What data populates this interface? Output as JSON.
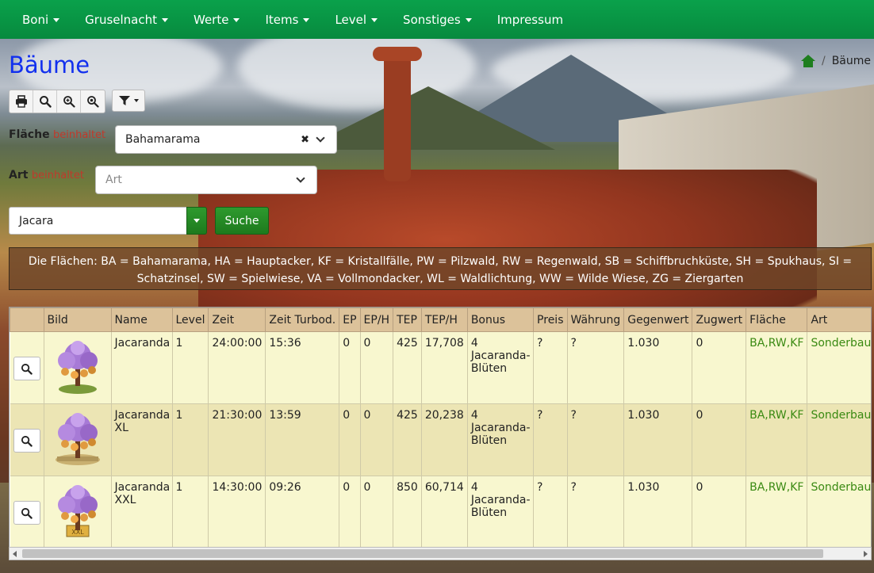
{
  "nav": {
    "items": [
      {
        "label": "Boni",
        "dropdown": true
      },
      {
        "label": "Gruselnacht",
        "dropdown": true
      },
      {
        "label": "Werte",
        "dropdown": true
      },
      {
        "label": "Items",
        "dropdown": true
      },
      {
        "label": "Level",
        "dropdown": true
      },
      {
        "label": "Sonstiges",
        "dropdown": true
      },
      {
        "label": "Impressum",
        "dropdown": false
      }
    ]
  },
  "page": {
    "title": "Bäume",
    "breadcrumb_separator": "/",
    "breadcrumb_current": "Bäume"
  },
  "toolbar": {
    "icons": [
      "printer-icon",
      "search-icon",
      "zoom-in-icon",
      "zoom-reset-icon",
      "filter-icon"
    ]
  },
  "filters": {
    "flaeche": {
      "label": "Fläche",
      "operator": "beinhaltet",
      "value": "Bahamarama"
    },
    "art": {
      "label": "Art",
      "operator": "beinhaltet",
      "placeholder": "Art"
    }
  },
  "search": {
    "value": "Jacara",
    "button_label": "Suche"
  },
  "legend_text": "Die Flächen: BA = Bahamarama, HA = Hauptacker, KF = Kristallfälle, PW = Pilzwald, RW = Regenwald, SB = Schiffbruchküste, SH = Spukhaus, SI = Schatzinsel, SW = Spielwiese, VA = Vollmondacker, WL = Waldlichtung, WW = Wilde Wiese, ZG = Ziergarten",
  "table": {
    "columns": [
      "",
      "Bild",
      "Name",
      "Level",
      "Zeit",
      "Zeit Turbod.",
      "EP",
      "EP/H",
      "TEP",
      "TEP/H",
      "Bonus",
      "Preis",
      "Währung",
      "Gegenwert",
      "Zugwert",
      "Fläche",
      "Art"
    ],
    "rows": [
      {
        "name": "Jacaranda",
        "level": "1",
        "zeit": "24:00:00",
        "zeit_turbo": "15:36",
        "ep": "0",
        "ep_h": "0",
        "tep": "425",
        "tep_h": "17,708",
        "bonus": "4 Jacaranda-Blüten",
        "preis": "?",
        "waehrung": "?",
        "gegenwert": "1.030",
        "zugwert": "0",
        "flaeche": "BA,RW,KF",
        "art": "Sonderbaum"
      },
      {
        "name": "Jacaranda XL",
        "level": "1",
        "zeit": "21:30:00",
        "zeit_turbo": "13:59",
        "ep": "0",
        "ep_h": "0",
        "tep": "425",
        "tep_h": "20,238",
        "bonus": "4 Jacaranda-Blüten",
        "preis": "?",
        "waehrung": "?",
        "gegenwert": "1.030",
        "zugwert": "0",
        "flaeche": "BA,RW,KF",
        "art": "Sonderbaum"
      },
      {
        "name": "Jacaranda XXL",
        "level": "1",
        "zeit": "14:30:00",
        "zeit_turbo": "09:26",
        "ep": "0",
        "ep_h": "0",
        "tep": "850",
        "tep_h": "60,714",
        "bonus": "4 Jacaranda-Blüten",
        "preis": "?",
        "waehrung": "?",
        "gegenwert": "1.030",
        "zugwert": "0",
        "flaeche": "BA,RW,KF",
        "art": "Sonderbaum"
      }
    ]
  },
  "colors": {
    "navbar": "#0aa14b",
    "title": "#1230ee",
    "header_row": "#dcc29a",
    "row_odd": "#f8f7cf",
    "row_even": "#ece5b4",
    "link_green": "#3a8a12",
    "button_green": "#1d7a1d"
  }
}
